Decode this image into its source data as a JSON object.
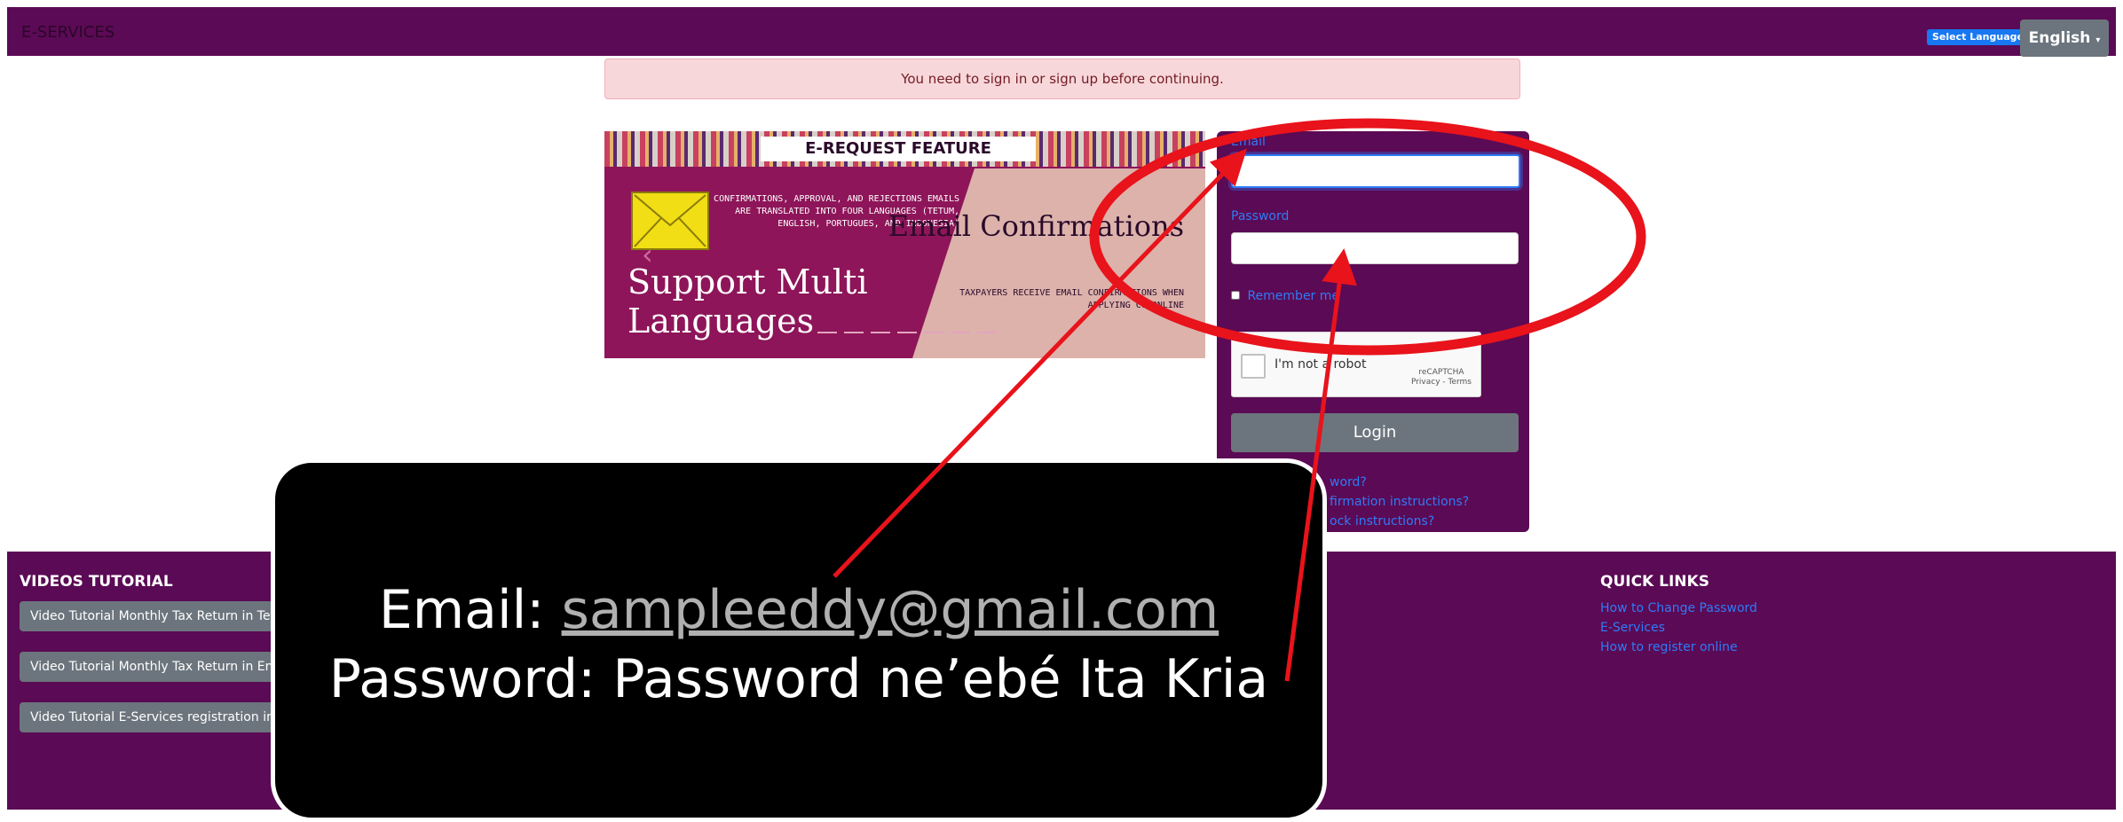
{
  "topbar": {
    "brand": "E-SERVICES",
    "select_language_label": "Select Language",
    "language_button": "English"
  },
  "alert": {
    "message": "You need to sign in or sign up before continuing."
  },
  "banner": {
    "feature_title": "E-REQUEST FEATURE",
    "left_small": "CONFIRMATIONS, APPROVAL, AND REJECTIONS EMAILS ARE TRANSLATED INTO FOUR LANGUAGES (TETUM, ENGLISH, PORTUGUES, AND INDONESIA)",
    "left_big": "Support Multi Languages",
    "right_big": "Email Confirmations",
    "right_small": "TAXPAYERS RECEIVE EMAIL CONFIRMATIONS WHEN APPLYING CO ONLINE",
    "icon": "envelope-icon"
  },
  "login_form": {
    "email_label": "Email",
    "email_value": "",
    "password_label": "Password",
    "password_value": "",
    "remember_label": "Remember me",
    "captcha_label": "I'm not a robot",
    "captcha_brand": "reCAPTCHA",
    "captcha_terms": "Privacy - Terms",
    "login_button": "Login",
    "links": [
      "word?",
      "firmation instructions?",
      "ock instructions?"
    ]
  },
  "footer": {
    "videos_heading": "VIDEOS TUTORIAL",
    "videos": [
      "Video Tutorial Monthly Tax Return in Tetu",
      "Video Tutorial Monthly Tax Return in Eng",
      "Video Tutorial E-Services registration in T"
    ],
    "quick_links_heading": "QUICK LINKS",
    "quick_links": [
      "How to Change Password",
      "E-Services",
      "How to register online"
    ]
  },
  "overlay": {
    "email_prefix": "Email: ",
    "email_value": "sampleeddy@gmail.com",
    "password_line": "Password: Password ne’ebé Ita Kria"
  },
  "colors": {
    "brand_purple": "#5b0a55",
    "link_blue": "#2e7cf6",
    "annotation_red": "#e8131b",
    "button_gray": "#6c757d"
  }
}
